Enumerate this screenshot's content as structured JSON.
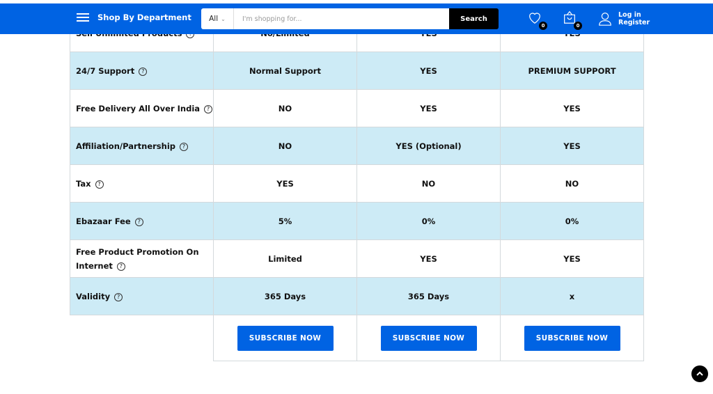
{
  "header": {
    "department_label": "Shop By Department",
    "search": {
      "category": "All",
      "placeholder": "I'm shopping for...",
      "value": "",
      "button": "Search"
    },
    "wishlist_count": "0",
    "cart_count": "0",
    "login": "Log in",
    "register": "Register"
  },
  "table": {
    "rows": [
      {
        "label": "Sell Unlimited Products",
        "values": [
          "No/Limited",
          "YES",
          "YES"
        ],
        "alt": false
      },
      {
        "label": "24/7 Support",
        "values": [
          "Normal Support",
          "YES",
          "PREMIUM SUPPORT"
        ],
        "alt": true
      },
      {
        "label": "Free Delivery All Over India",
        "values": [
          "NO",
          "YES",
          "YES"
        ],
        "alt": false
      },
      {
        "label": "Affiliation/Partnership",
        "values": [
          "NO",
          "YES (Optional)",
          "YES"
        ],
        "alt": true
      },
      {
        "label": "Tax",
        "values": [
          "YES",
          "NO",
          "NO"
        ],
        "alt": false
      },
      {
        "label": "Ebazaar Fee",
        "values": [
          "5%",
          "0%",
          "0%"
        ],
        "alt": true
      },
      {
        "label": "Free Product Promotion On Internet",
        "values": [
          "Limited",
          "YES",
          "YES"
        ],
        "alt": false
      },
      {
        "label": "Validity",
        "values": [
          "365 Days",
          "365 Days",
          "x"
        ],
        "alt": true
      }
    ],
    "help_glyph": "?",
    "subscribe_label": "SUBSCRIBE NOW"
  },
  "colors": {
    "brand": "#0063e3",
    "row_alt": "#cdebf6"
  }
}
